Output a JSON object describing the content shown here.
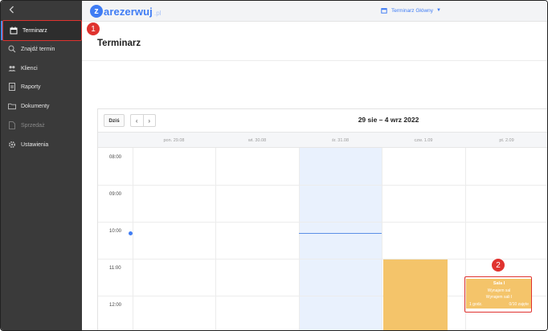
{
  "sidebar": {
    "items": [
      {
        "label": "Terminarz",
        "icon": "calendar-icon"
      },
      {
        "label": "Znajdź termin",
        "icon": "search-icon"
      },
      {
        "label": "Klienci",
        "icon": "users-icon"
      },
      {
        "label": "Raporty",
        "icon": "report-icon"
      },
      {
        "label": "Dokumenty",
        "icon": "folder-icon"
      },
      {
        "label": "Sprzedaż",
        "icon": "document-icon"
      },
      {
        "label": "Ustawienia",
        "icon": "gear-icon"
      }
    ]
  },
  "annotations": {
    "badge1": "1",
    "badge2": "2"
  },
  "topbar": {
    "logo_letter": "z",
    "logo_text": "arezerwuj",
    "logo_suffix": ".pl",
    "calendar_selector": "Terminarz Główny"
  },
  "page": {
    "title": "Terminarz"
  },
  "calendar": {
    "today_label": "Dziś",
    "prev": "‹",
    "next": "›",
    "range": "29 sie – 4 wrz 2022",
    "days": [
      "pon. 29.08",
      "wt. 30.08",
      "śr. 31.08",
      "czw. 1.09",
      "pt. 2.09"
    ],
    "times": [
      "08:00",
      "09:00",
      "10:00",
      "11:00",
      "12:00"
    ],
    "event": {
      "title": "Sala I",
      "line1": "Wynajem sal",
      "line2": "Wynajem sali I",
      "duration": "1 godz.",
      "occupancy": "0/10 zajęte"
    }
  },
  "colors": {
    "accent": "#3f7cf4",
    "event": "#f4c46a",
    "highlight": "#e0332f"
  }
}
